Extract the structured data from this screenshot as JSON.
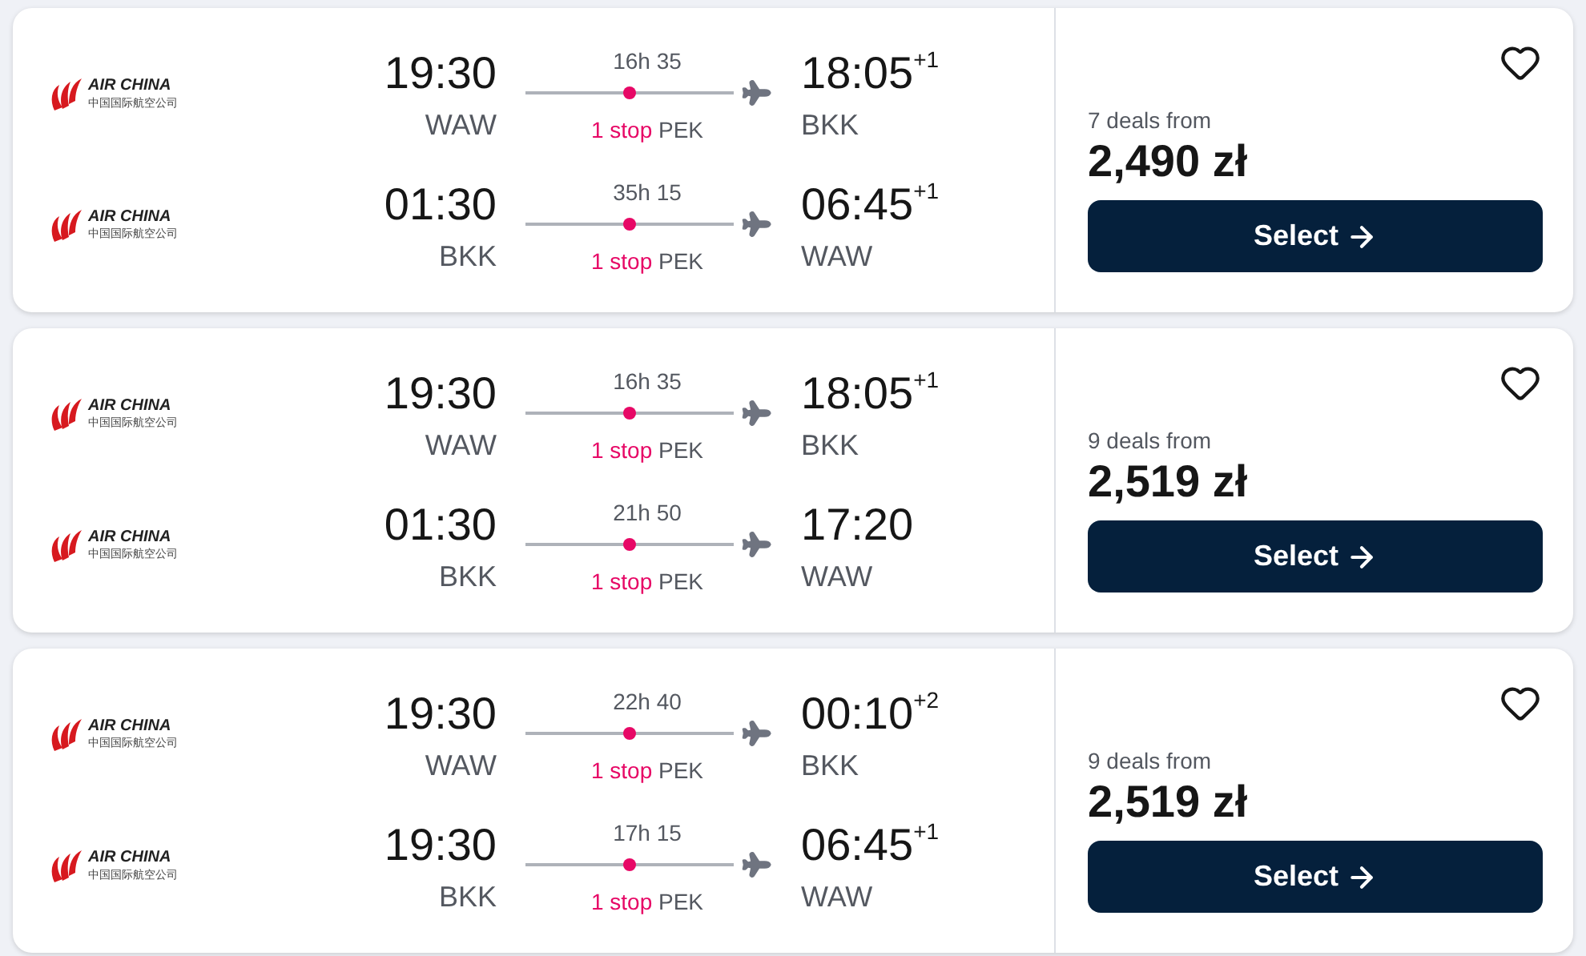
{
  "results": [
    {
      "legs": [
        {
          "airline": "AIR CHINA",
          "airline_native": "中国国际航空公司",
          "depart_time": "19:30",
          "depart_airport": "WAW",
          "duration": "16h 35",
          "stops": "1 stop",
          "via": "PEK",
          "arrive_time": "18:05",
          "day_offset": "+1",
          "arrive_airport": "BKK"
        },
        {
          "airline": "AIR CHINA",
          "airline_native": "中国国际航空公司",
          "depart_time": "01:30",
          "depart_airport": "BKK",
          "duration": "35h 15",
          "stops": "1 stop",
          "via": "PEK",
          "arrive_time": "06:45",
          "day_offset": "+1",
          "arrive_airport": "WAW"
        }
      ],
      "deals": "7 deals from",
      "price": "2,490 zł",
      "button": "Select",
      "saved": false
    },
    {
      "legs": [
        {
          "airline": "AIR CHINA",
          "airline_native": "中国国际航空公司",
          "depart_time": "19:30",
          "depart_airport": "WAW",
          "duration": "16h 35",
          "stops": "1 stop",
          "via": "PEK",
          "arrive_time": "18:05",
          "day_offset": "+1",
          "arrive_airport": "BKK"
        },
        {
          "airline": "AIR CHINA",
          "airline_native": "中国国际航空公司",
          "depart_time": "01:30",
          "depart_airport": "BKK",
          "duration": "21h 50",
          "stops": "1 stop",
          "via": "PEK",
          "arrive_time": "17:20",
          "arrive_airport": "WAW"
        }
      ],
      "deals": "9 deals from",
      "price": "2,519 zł",
      "button": "Select",
      "saved": false
    },
    {
      "legs": [
        {
          "airline": "AIR CHINA",
          "airline_native": "中国国际航空公司",
          "depart_time": "19:30",
          "depart_airport": "WAW",
          "duration": "22h 40",
          "stops": "1 stop",
          "via": "PEK",
          "arrive_time": "00:10",
          "day_offset": "+2",
          "arrive_airport": "BKK"
        },
        {
          "airline": "AIR CHINA",
          "airline_native": "中国国际航空公司",
          "depart_time": "19:30",
          "depart_airport": "BKK",
          "duration": "17h 15",
          "stops": "1 stop",
          "via": "PEK",
          "arrive_time": "06:45",
          "day_offset": "+1",
          "arrive_airport": "WAW"
        }
      ],
      "deals": "9 deals from",
      "price": "2,519 zł",
      "button": "Select",
      "saved": false
    }
  ]
}
